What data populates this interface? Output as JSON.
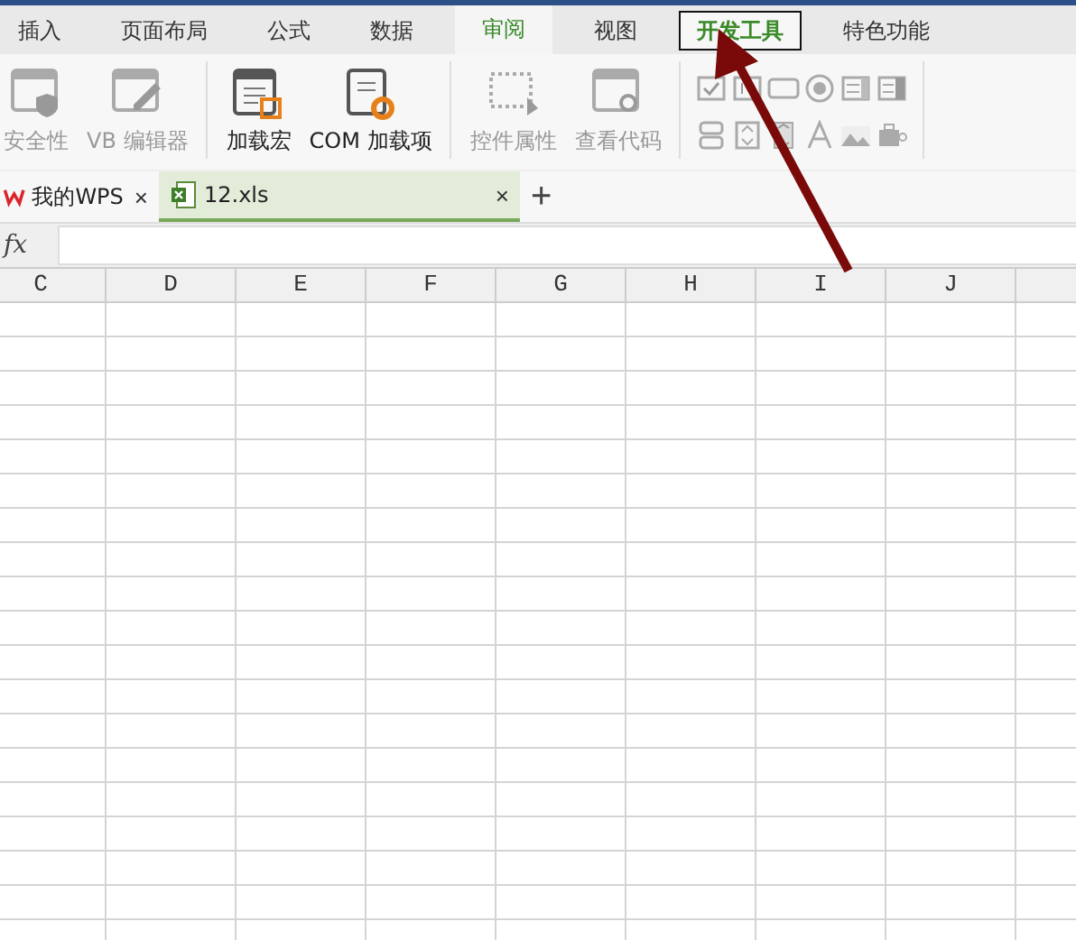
{
  "menu_tabs": [
    {
      "label": "插入",
      "selected": false,
      "hover": false
    },
    {
      "label": "页面布局",
      "selected": false,
      "hover": false
    },
    {
      "label": "公式",
      "selected": false,
      "hover": false
    },
    {
      "label": "数据",
      "selected": false,
      "hover": false
    },
    {
      "label": "审阅",
      "selected": false,
      "hover": true
    },
    {
      "label": "视图",
      "selected": false,
      "hover": false
    },
    {
      "label": "开发工具",
      "selected": true,
      "hover": false
    },
    {
      "label": "特色功能",
      "selected": false,
      "hover": false
    }
  ],
  "ribbon_groups": [
    [
      {
        "label": "安全性",
        "disabled": true,
        "kind": "shield"
      },
      {
        "label": "VB 编辑器",
        "disabled": true,
        "kind": "editor"
      }
    ],
    [
      {
        "label": "加载宏",
        "disabled": false,
        "kind": "macro"
      },
      {
        "label": "COM 加载项",
        "disabled": false,
        "kind": "gear"
      }
    ],
    [
      {
        "label": "控件属性",
        "disabled": true,
        "kind": "select"
      },
      {
        "label": "查看代码",
        "disabled": true,
        "kind": "code"
      }
    ]
  ],
  "doc_tabs": [
    {
      "label": "我的WPS",
      "selected": false,
      "kind": "home",
      "close": "×"
    },
    {
      "label": "12.xls",
      "selected": true,
      "kind": "sheet",
      "close": "×"
    }
  ],
  "new_tab": "+",
  "fx_label": "fx",
  "columns": [
    "C",
    "D",
    "E",
    "F",
    "G",
    "H",
    "I",
    "J"
  ]
}
